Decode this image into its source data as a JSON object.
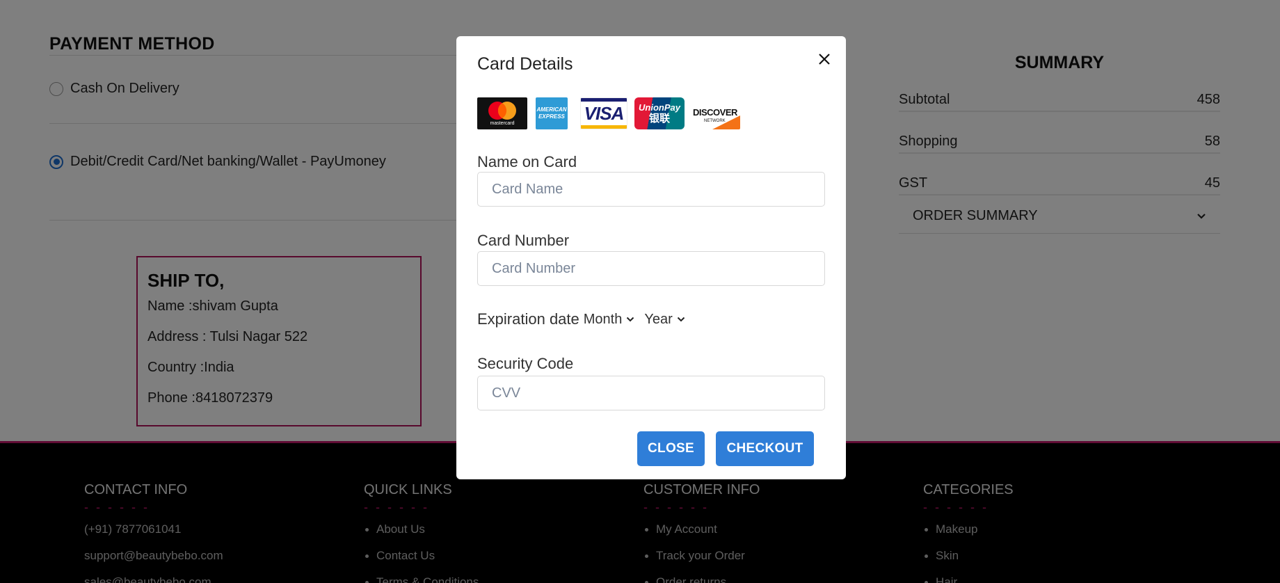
{
  "payment": {
    "title": "PAYMENT METHOD",
    "options": [
      {
        "label": "Cash On Delivery",
        "selected": false
      },
      {
        "label": "Debit/Credit Card/Net banking/Wallet - PayUmoney",
        "selected": true
      }
    ]
  },
  "ship_to": {
    "title": "SHIP TO,",
    "name": "Name :shivam Gupta",
    "address": "Address : Tulsi Nagar 522",
    "country": "Country :India",
    "phone": "Phone :8418072379"
  },
  "summary": {
    "title": "SUMMARY",
    "rows": [
      {
        "label": "Subtotal",
        "value": "458"
      },
      {
        "label": "Shopping",
        "value": "58"
      },
      {
        "label": "GST",
        "value": "45"
      }
    ],
    "order_summary_label": "ORDER SUMMARY"
  },
  "footer": {
    "contact": {
      "heading": "CONTACT INFO",
      "dashes": "- - - - - -",
      "lines": [
        "(+91) 7877061041",
        "support@beautybebo.com",
        "sales@beautybebo.com"
      ]
    },
    "quick_links": {
      "heading": "QUICK LINKS",
      "dashes": "- - - - - -",
      "items": [
        "About Us",
        "Contact Us",
        "Terms & Conditions"
      ]
    },
    "customer_info": {
      "heading": "CUSTOMER INFO",
      "dashes": "- - - - - -",
      "items": [
        "My Account",
        "Track your Order",
        "Order returns"
      ]
    },
    "categories": {
      "heading": "CATEGORIES",
      "dashes": "- - - - - -",
      "items": [
        "Makeup",
        "Skin",
        "Hair"
      ]
    }
  },
  "modal": {
    "title": "Card Details",
    "card_logos": {
      "mastercard": "mastercard",
      "amex_line1": "AMERICAN",
      "amex_line2": "EXPRESS",
      "visa": "VISA",
      "unionpay": "UnionPay",
      "unionpay_cn": "银联",
      "discover": "DISCOVER",
      "discover_sub": "NETWORK"
    },
    "name_label": "Name on Card",
    "name_placeholder": "Card Name",
    "number_label": "Card Number",
    "number_placeholder": "Card Number",
    "expiration_label": "Expiration date",
    "month_label": "Month",
    "year_label": "Year",
    "security_label": "Security Code",
    "security_placeholder": "CVV",
    "close_button": "CLOSE",
    "checkout_button": "CHECKOUT"
  },
  "colors": {
    "accent_blue": "#2f7ed8",
    "brand_pink": "#c2186b",
    "ship_border": "#b0125a"
  }
}
